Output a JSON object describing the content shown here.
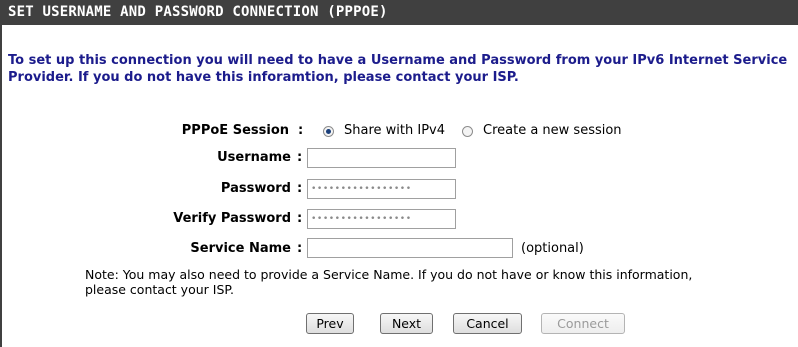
{
  "section": {
    "title": "SET USERNAME AND PASSWORD CONNECTION (PPPOE)",
    "intro": "To set up this connection you will need to have a Username and Password from your IPv6 Internet Service Provider. If you do not have this inforamtion, please contact your ISP."
  },
  "form": {
    "pppoe_session": {
      "label": "PPPoE Session",
      "options": [
        {
          "label": "Share with IPv4",
          "selected": true
        },
        {
          "label": "Create a new session",
          "selected": false
        }
      ]
    },
    "username": {
      "label": "Username",
      "value": ""
    },
    "password": {
      "label": "Password",
      "value": "•••••••••••••••••"
    },
    "verify_password": {
      "label": "Verify Password",
      "value": "•••••••••••••••••"
    },
    "service_name": {
      "label": "Service Name",
      "value": "",
      "hint": "(optional)"
    },
    "colon": ":"
  },
  "note": "Note: You may also need to provide a Service Name. If you do not have or know this information, please contact your ISP.",
  "buttons": {
    "prev": "Prev",
    "next": "Next",
    "cancel": "Cancel",
    "connect": "Connect"
  },
  "colors": {
    "header_bg": "#404040",
    "intro_text": "#1c1c8c"
  }
}
